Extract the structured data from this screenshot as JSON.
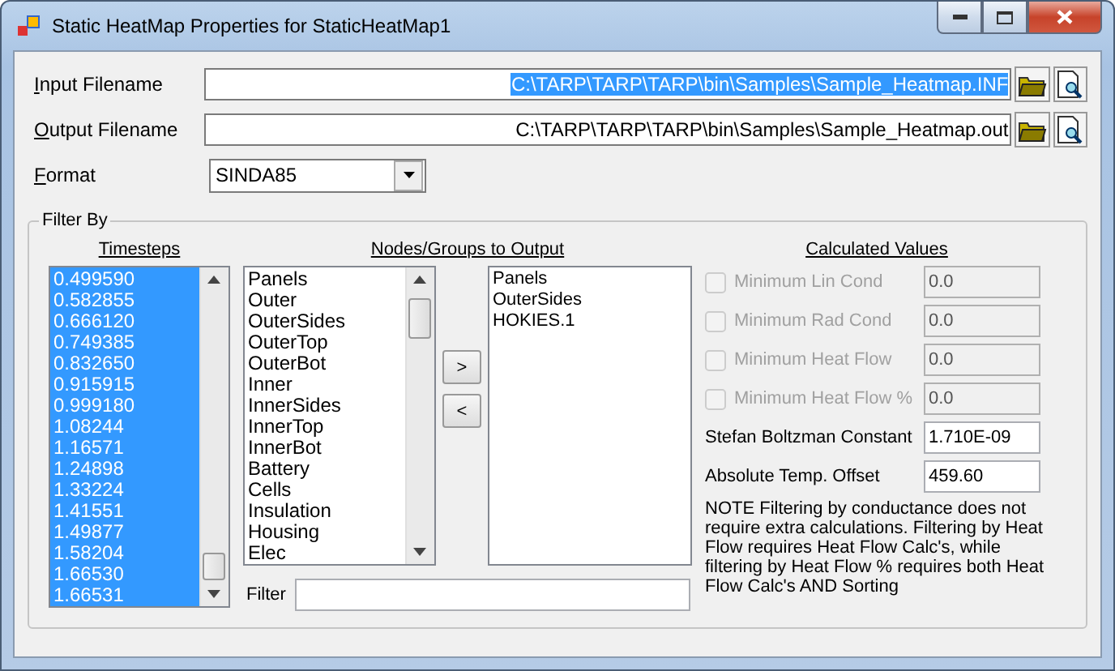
{
  "window": {
    "title": "Static HeatMap Properties for StaticHeatMap1"
  },
  "files": [
    {
      "label": "Input Filename",
      "value": "C:\\TARP\\TARP\\TARP\\bin\\Samples\\Sample_Heatmap.INF",
      "selected": true
    },
    {
      "label": "Output Filename",
      "value": "C:\\TARP\\TARP\\TARP\\bin\\Samples\\Sample_Heatmap.out",
      "selected": false
    }
  ],
  "format": {
    "label": "Format",
    "value": "SINDA85"
  },
  "filter_by": {
    "title": "Filter By",
    "timesteps": {
      "heading": "Timesteps",
      "items": [
        {
          "label": "0.499590",
          "selected": true
        },
        {
          "label": "0.582855",
          "selected": true
        },
        {
          "label": "0.666120",
          "selected": true
        },
        {
          "label": "0.749385",
          "selected": true
        },
        {
          "label": "0.832650",
          "selected": true
        },
        {
          "label": "0.915915",
          "selected": true
        },
        {
          "label": "0.999180",
          "selected": true
        },
        {
          "label": "1.08244",
          "selected": true
        },
        {
          "label": "1.16571",
          "selected": true
        },
        {
          "label": "1.24898",
          "selected": true
        },
        {
          "label": "1.33224",
          "selected": true
        },
        {
          "label": "1.41551",
          "selected": true
        },
        {
          "label": "1.49877",
          "selected": true
        },
        {
          "label": "1.58204",
          "selected": true
        },
        {
          "label": "1.66530",
          "selected": true
        },
        {
          "label": "1.66531",
          "selected": true
        }
      ]
    },
    "nodes": {
      "heading": "Nodes/Groups to Output",
      "available": [
        "Panels",
        "Outer",
        "OuterSides",
        "OuterTop",
        "OuterBot",
        "Inner",
        "InnerSides",
        "InnerTop",
        "InnerBot",
        "Battery",
        "Cells",
        "Insulation",
        "Housing",
        "Elec"
      ],
      "chosen": [
        "Panels",
        "OuterSides",
        "HOKIES.1"
      ],
      "add_button": ">",
      "remove_button": "<",
      "filter": {
        "label": "Filter"
      }
    },
    "calculated": {
      "heading": "Calculated Values",
      "rows": [
        {
          "kind": "check",
          "label": "Minimum Lin Cond",
          "value": "0.0",
          "checked": false,
          "disabled": true
        },
        {
          "kind": "check",
          "label": "Minimum Rad Cond",
          "value": "0.0",
          "checked": false,
          "disabled": true
        },
        {
          "kind": "check",
          "label": "Minimum Heat Flow",
          "value": "0.0",
          "checked": false,
          "disabled": true
        },
        {
          "kind": "check",
          "label": "Minimum Heat Flow %",
          "value": "0.0",
          "checked": false,
          "disabled": true
        },
        {
          "kind": "text",
          "label": "Stefan Boltzman Constant",
          "value": "1.710E-09"
        },
        {
          "kind": "text",
          "label": "Absolute Temp. Offset",
          "value": "459.60"
        }
      ],
      "note": "NOTE Filtering by conductance does not require extra calculations.  Filtering by Heat Flow requires Heat Flow Calc's, while filtering by Heat Flow % requires both Heat Flow Calc's AND Sorting"
    }
  }
}
